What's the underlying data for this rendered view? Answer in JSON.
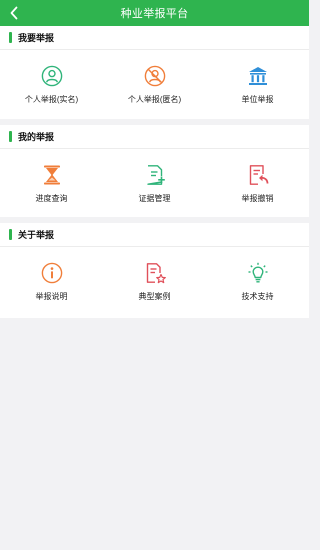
{
  "header": {
    "title": "种业举报平台",
    "back_icon": "back-arrow-icon"
  },
  "sections": [
    {
      "title": "我要举报",
      "items": [
        {
          "label": "个人举报(实名)",
          "icon": "person-icon",
          "color": "#2fb47a"
        },
        {
          "label": "个人举报(匿名)",
          "icon": "person-anonymous-icon",
          "color": "#f07e3a"
        },
        {
          "label": "单位举报",
          "icon": "building-icon",
          "color": "#2f8fd8"
        }
      ]
    },
    {
      "title": "我的举报",
      "items": [
        {
          "label": "进度查询",
          "icon": "hourglass-icon",
          "color": "#f07e3a"
        },
        {
          "label": "证据管理",
          "icon": "document-add-icon",
          "color": "#2fb47a"
        },
        {
          "label": "举报撤销",
          "icon": "document-undo-icon",
          "color": "#e0505a"
        }
      ]
    },
    {
      "title": "关于举报",
      "items": [
        {
          "label": "举报说明",
          "icon": "info-icon",
          "color": "#f07e3a"
        },
        {
          "label": "典型案例",
          "icon": "document-star-icon",
          "color": "#e0505a"
        },
        {
          "label": "技术支持",
          "icon": "lightbulb-icon",
          "color": "#2fb47a"
        }
      ]
    }
  ],
  "colors": {
    "brand": "#2fb44f",
    "background": "#f2f2f4"
  }
}
